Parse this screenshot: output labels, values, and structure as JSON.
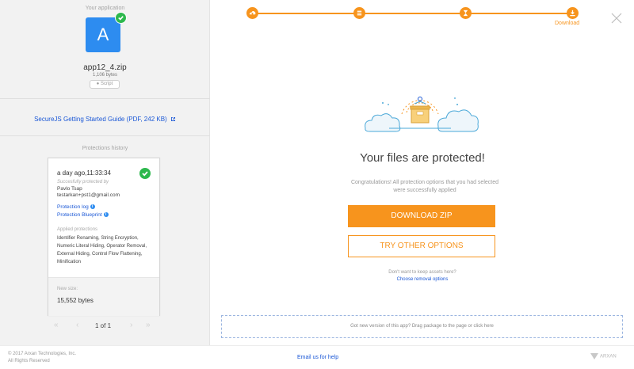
{
  "sidebar": {
    "app_section_title": "Your application",
    "app_icon_letter": "A",
    "app_name": "app12_4.zip",
    "app_size": "1,106 bytes",
    "type_badge": "Script",
    "guide_link": "SecureJS Getting Started Guide (PDF,  242 KB)",
    "history_title": "Protections history",
    "history_card": {
      "date": "a day ago,11:33:34",
      "protected_by_label": "Succesfully protected by",
      "user_name": "Pavlo Tsap",
      "user_email": "testarkan+pst1@gmail.com",
      "protection_log": "Protection log",
      "protection_blueprint": "Protection Blueprint",
      "applied_label": "Applied protections",
      "applied_list": "Identifier Renaming, String Encryption, Numeric Literal Hiding, Operator Removal, External Hiding, Control Flow Flattening, Minification",
      "new_size_label": "New size:",
      "new_size_value": "15,552 bytes"
    },
    "pager": {
      "text": "1 of 1",
      "first": "«",
      "prev": "‹",
      "next": "›",
      "last": "»"
    }
  },
  "steps": {
    "current_label": "Download",
    "icons": [
      "upload-icon",
      "list-icon",
      "hourglass-icon",
      "download-icon"
    ]
  },
  "main": {
    "title": "Your files are protected!",
    "message": "Congratulations! All protection options that you had selected were successfully applied",
    "download_button": "DOWNLOAD ZIP",
    "try_button": "TRY OTHER OPTIONS",
    "keep_question": "Don't want to keep assets here?",
    "removal_link": "Choose removal options",
    "drop_zone_text": "Got new version of this app? Drag package to the page or click here"
  },
  "footer": {
    "copyright_line1": "© 2017 Arxan Technologies, Inc.",
    "copyright_line2": "All Rights Reserved",
    "email_link": "Email us for help",
    "brand": "ARXAN"
  },
  "colors": {
    "accent": "#f7941d",
    "link": "#1a57d6",
    "success": "#2db84d",
    "app_icon": "#2d8cf0"
  }
}
